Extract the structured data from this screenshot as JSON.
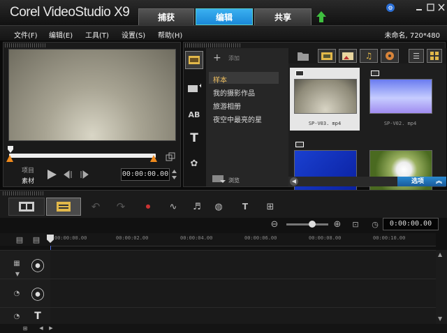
{
  "title": {
    "logo": "Corel VideoStudio X9"
  },
  "tabs": [
    {
      "label": "捕获"
    },
    {
      "label": "编辑"
    },
    {
      "label": "共享"
    }
  ],
  "menu": [
    {
      "label": "文件(F)"
    },
    {
      "label": "编辑(E)"
    },
    {
      "label": "工具(T)"
    },
    {
      "label": "设置(S)"
    },
    {
      "label": "帮助(H)"
    }
  ],
  "project_info": "未命名, 720*480",
  "player": {
    "mode_project": "项目",
    "mode_clip": "素材",
    "timecode": "00:00:00.00"
  },
  "library": {
    "add_label": "添加",
    "folders": [
      {
        "label": "样本"
      },
      {
        "label": "我的摄影作品"
      },
      {
        "label": "旅游相册"
      },
      {
        "label": "夜空中最亮的星"
      }
    ],
    "browse_label": "浏览",
    "options_label": "选项",
    "thumbnails": [
      {
        "caption": "SP-V03. mp4"
      },
      {
        "caption": "SP-V02. mp4"
      },
      {
        "caption": ""
      },
      {
        "caption": ""
      }
    ]
  },
  "timeline": {
    "timecode": "0:00:00.00",
    "ruler": [
      "00:00:00.00",
      "00:00:02.00",
      "00:00:04.00",
      "00:00:06.00",
      "00:00:08.00",
      "00:00:10.00"
    ]
  },
  "colors": {
    "accent": "#2aa0e8",
    "selected_folder": "#3a3a3a"
  }
}
